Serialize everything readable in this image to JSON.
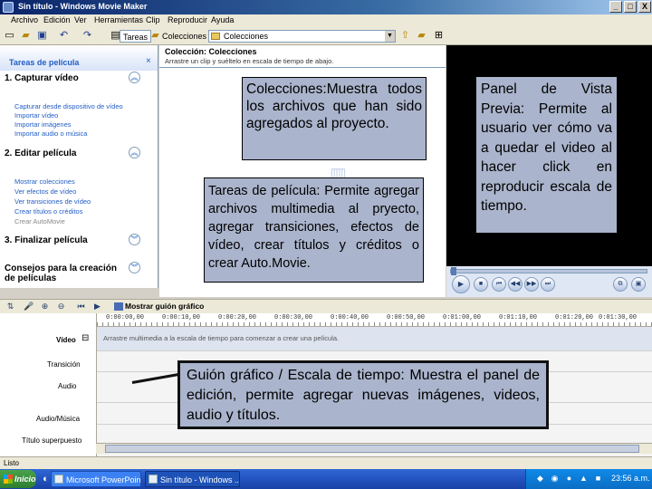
{
  "window": {
    "title": "Sin título - Windows Movie Maker",
    "minimize": "_",
    "maximize": "□",
    "close": "X"
  },
  "menu": [
    "Archivo",
    "Edición",
    "Ver",
    "Herramientas",
    "Clip",
    "Reproducir",
    "Ayuda"
  ],
  "toolbar": {
    "tasks_label": "Tareas",
    "collections_label": "Colecciones",
    "combo_value": "Colecciones"
  },
  "taskpane": {
    "title": "Tareas de película",
    "close": "×",
    "sections": [
      {
        "label": "1. Capturar vídeo",
        "chevron": "︽",
        "links": [
          "Capturar desde dispositivo de vídeo",
          "Importar vídeo",
          "Importar imágenes",
          "Importar audio o música"
        ]
      },
      {
        "label": "2. Editar película",
        "chevron": "︽",
        "links": [
          "Mostrar colecciones",
          "Ver efectos de vídeo",
          "Ver transiciones de vídeo",
          "Crear títulos o créditos",
          "Crear AutoMovie"
        ]
      },
      {
        "label": "3. Finalizar película",
        "chevron": "︾",
        "links": []
      },
      {
        "label": "Consejos para la creación de películas",
        "chevron": "︾",
        "links": []
      }
    ]
  },
  "collections": {
    "title": "Colección: Colecciones",
    "subtitle": "Arrastre un clip y suéltelo en escala de tiempo de abajo."
  },
  "storyboard": {
    "show_label": "Mostrar guión gráfico",
    "ruler": [
      "0:00:00,00",
      "0:00:10,00",
      "0:00:20,00",
      "0:00:30,00",
      "0:00:40,00",
      "0:00:50,00",
      "0:01:00,00",
      "0:01:10,00",
      "0:01:20,00",
      "0:01:30,00"
    ],
    "tracks": [
      "Vídeo",
      "Transición",
      "Audio",
      "Audio/Música",
      "Título superpuesto"
    ],
    "video_hint": "Arrastre multimedia a la escala de tiempo para comenzar a crear una película."
  },
  "status": {
    "text": "Listo"
  },
  "taskbar": {
    "start_label": "Inicio",
    "tasks": [
      "Microsoft PowerPoint - [...",
      "Sin título - Windows ..."
    ],
    "clock": "23:56 a.m."
  },
  "annotations": {
    "collections_note": "Colecciones:Muestra todos los archivos que han sido agregados al proyecto.",
    "tasks_note": "Tareas de película: Permite agregar archivos multimedia al pryecto, agregar transiciones, efectos de vídeo, crear títulos y créditos o crear Auto.Movie.",
    "preview_note": "Panel de Vista Previa: Permite al usuario ver cómo va a quedar el video al hacer click en reproducir escala de tiempo.",
    "storyboard_note": "Guión gráfico / Escala de tiempo: Muestra el panel de edición, permite agregar nuevas imágenes, videos, audio y títulos."
  }
}
